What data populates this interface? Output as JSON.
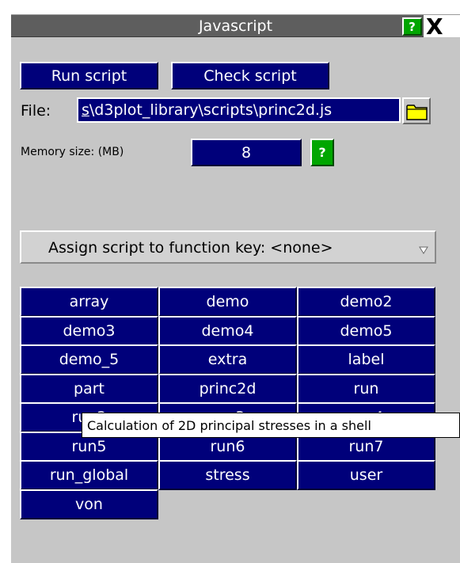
{
  "window": {
    "title": "Javascript",
    "help_label": "?",
    "close_label": "X"
  },
  "toolbar": {
    "run_label": "Run script",
    "check_label": "Check script"
  },
  "file": {
    "label": "File:",
    "value_first_char": "s",
    "value_rest": "\\d3plot_library\\scripts\\princ2d.js",
    "folder_icon": "folder-icon"
  },
  "memory": {
    "label": "Memory size: (MB)",
    "value": "8",
    "help_label": "?"
  },
  "assign": {
    "label": "Assign script to function key: <none>",
    "arrow_icon": "dropdown-arrow-icon"
  },
  "scripts": [
    "array",
    "demo",
    "demo2",
    "demo3",
    "demo4",
    "demo5",
    "demo_5",
    "extra",
    "label",
    "part",
    "princ2d",
    "run",
    "run2",
    "run3",
    "run4",
    "run5",
    "run6",
    "run7",
    "run_global",
    "stress",
    "user",
    "von"
  ],
  "tooltip": {
    "text": "Calculation of 2D principal stresses in a shell"
  },
  "colors": {
    "button_blue": "#00007a",
    "panel_gray": "#c6c6c6",
    "title_gray": "#5e5e5e",
    "help_green": "#00a600",
    "folder_yellow": "#ffff00"
  }
}
